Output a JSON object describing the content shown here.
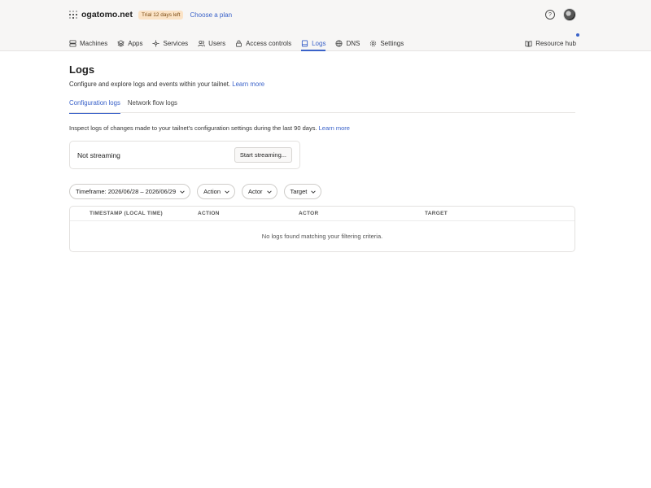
{
  "header": {
    "tailnet_name": "ogatomo.net",
    "trial_badge": "Trial 12 days left",
    "choose_plan": "Choose a plan",
    "help_icon": "question-circle-icon",
    "avatar_icon": "user-avatar"
  },
  "nav": {
    "items": [
      {
        "label": "Machines",
        "icon": "server-icon"
      },
      {
        "label": "Apps",
        "icon": "apps-icon"
      },
      {
        "label": "Services",
        "icon": "services-icon"
      },
      {
        "label": "Users",
        "icon": "users-icon"
      },
      {
        "label": "Access controls",
        "icon": "lock-icon"
      },
      {
        "label": "Logs",
        "icon": "logs-icon",
        "active": true
      },
      {
        "label": "DNS",
        "icon": "globe-icon"
      },
      {
        "label": "Settings",
        "icon": "gear-icon"
      }
    ],
    "resource_hub": "Resource hub"
  },
  "page": {
    "title": "Logs",
    "description": "Configure and explore logs and events within your tailnet.",
    "learn_more": "Learn more"
  },
  "tabs": [
    {
      "label": "Configuration logs",
      "active": true
    },
    {
      "label": "Network flow logs",
      "active": false
    }
  ],
  "config_logs": {
    "inspect_text": "Inspect logs of changes made to your tailnet's configuration settings during the last 90 days.",
    "learn_more": "Learn more",
    "stream_status": "Not streaming",
    "stream_button": "Start streaming..."
  },
  "filters": {
    "timeframe": "Timeframe: 2026/06/28 – 2026/06/29",
    "action": "Action",
    "actor": "Actor",
    "target": "Target"
  },
  "table": {
    "columns": [
      "TIMESTAMP (LOCAL TIME)",
      "ACTION",
      "ACTOR",
      "TARGET"
    ],
    "empty_message": "No logs found matching your filtering criteria."
  },
  "colors": {
    "accent": "#3a62c9",
    "trial_bg": "#fbe3c6",
    "topbar_bg": "#f7f6f5"
  }
}
